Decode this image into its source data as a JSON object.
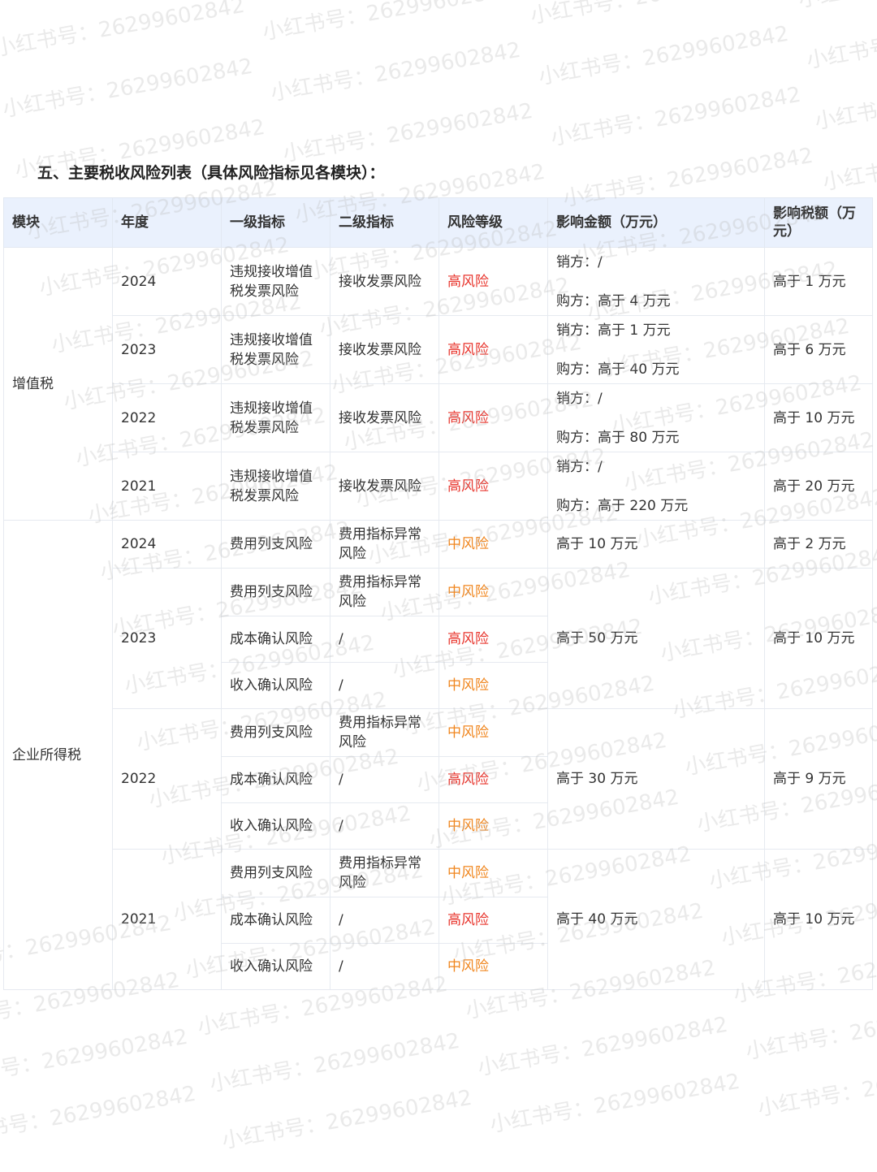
{
  "title": "五、主要税收风险列表（具体风险指标见各模块）：",
  "headers": [
    "模块",
    "年度",
    "一级指标",
    "二级指标",
    "风险等级",
    "影响金额（万元）",
    "影响税额（万元）"
  ],
  "colors": {
    "high": "#e8352d",
    "mid": "#f0861e",
    "header_bg": "#eaf1fd"
  },
  "watermark": "小红书号：26299602842",
  "vat": {
    "module": "增值税",
    "rows": [
      {
        "year": "2024",
        "l1": "违规接收增值税发票风险",
        "l2": "接收发票风险",
        "level": "高风险",
        "sales": "销方：/",
        "buy": "购方：高于 4 万元",
        "tax": "高于 1 万元"
      },
      {
        "year": "2023",
        "l1": "违规接收增值税发票风险",
        "l2": "接收发票风险",
        "level": "高风险",
        "sales": "销方：高于 1 万元",
        "buy": "购方：高于 40 万元",
        "tax": "高于 6 万元"
      },
      {
        "year": "2022",
        "l1": "违规接收增值税发票风险",
        "l2": "接收发票风险",
        "level": "高风险",
        "sales": "销方：/",
        "buy": "购方：高于 80 万元",
        "tax": "高于 10 万元"
      },
      {
        "year": "2021",
        "l1": "违规接收增值税发票风险",
        "l2": "接收发票风险",
        "level": "高风险",
        "sales": "销方：/",
        "buy": "购方：高于 220 万元",
        "tax": "高于 20 万元"
      }
    ]
  },
  "cit": {
    "module": "企业所得税",
    "y2024": {
      "year": "2024",
      "l1": "费用列支风险",
      "l2": "费用指标异常风险",
      "level": "中风险",
      "amount": "高于 10 万元",
      "tax": "高于 2 万元"
    },
    "y2023": {
      "year": "2023",
      "amount": "高于 50 万元",
      "tax": "高于 10 万元",
      "rows": [
        {
          "l1": "费用列支风险",
          "l2": "费用指标异常风险",
          "level": "中风险"
        },
        {
          "l1": "成本确认风险",
          "l2": "/",
          "level": "高风险"
        },
        {
          "l1": "收入确认风险",
          "l2": "/",
          "level": "中风险"
        }
      ]
    },
    "y2022": {
      "year": "2022",
      "amount": "高于 30 万元",
      "tax": "高于 9 万元",
      "rows": [
        {
          "l1": "费用列支风险",
          "l2": "费用指标异常风险",
          "level": "中风险"
        },
        {
          "l1": "成本确认风险",
          "l2": "/",
          "level": "高风险"
        },
        {
          "l1": "收入确认风险",
          "l2": "/",
          "level": "中风险"
        }
      ]
    },
    "y2021": {
      "year": "2021",
      "amount": "高于 40 万元",
      "tax": "高于 10 万元",
      "rows": [
        {
          "l1": "费用列支风险",
          "l2": "费用指标异常风险",
          "level": "中风险"
        },
        {
          "l1": "成本确认风险",
          "l2": "/",
          "level": "高风险"
        },
        {
          "l1": "收入确认风险",
          "l2": "/",
          "level": "中风险"
        }
      ]
    }
  }
}
